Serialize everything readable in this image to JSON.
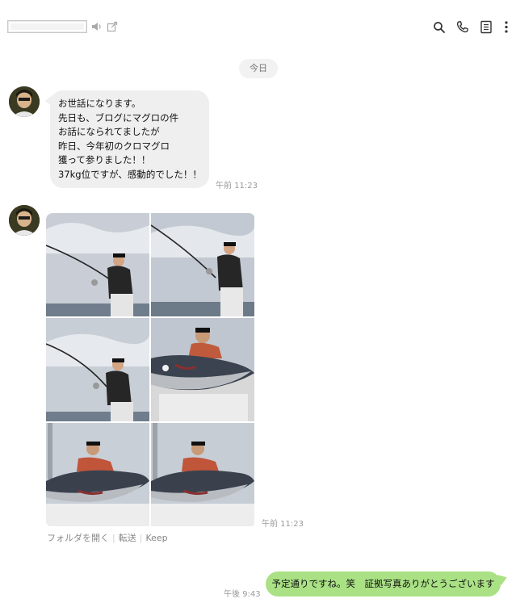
{
  "header": {
    "icons": [
      "speaker-icon",
      "popout-icon",
      "search-icon",
      "phone-icon",
      "notes-icon",
      "more-icon"
    ]
  },
  "date_label": "今日",
  "message_in": {
    "lines": [
      "お世話になります。",
      "先日も、ブログにマグロの件",
      "お話になられてましたが",
      "昨日、今年初のクロマグロ",
      "獲って参りました！！",
      "37kg位ですが、感動的でした！！"
    ],
    "time": "午前 11:23"
  },
  "photo_message": {
    "time": "午前 11:23",
    "actions": [
      "フォルダを開く",
      "転送",
      "Keep"
    ]
  },
  "message_out": {
    "text": "予定通りですね。笑　証拠写真ありがとうございます",
    "time": "午後 9:43"
  },
  "colors": {
    "outgoing_bubble": "#a9e184",
    "incoming_bubble": "#efefef"
  }
}
